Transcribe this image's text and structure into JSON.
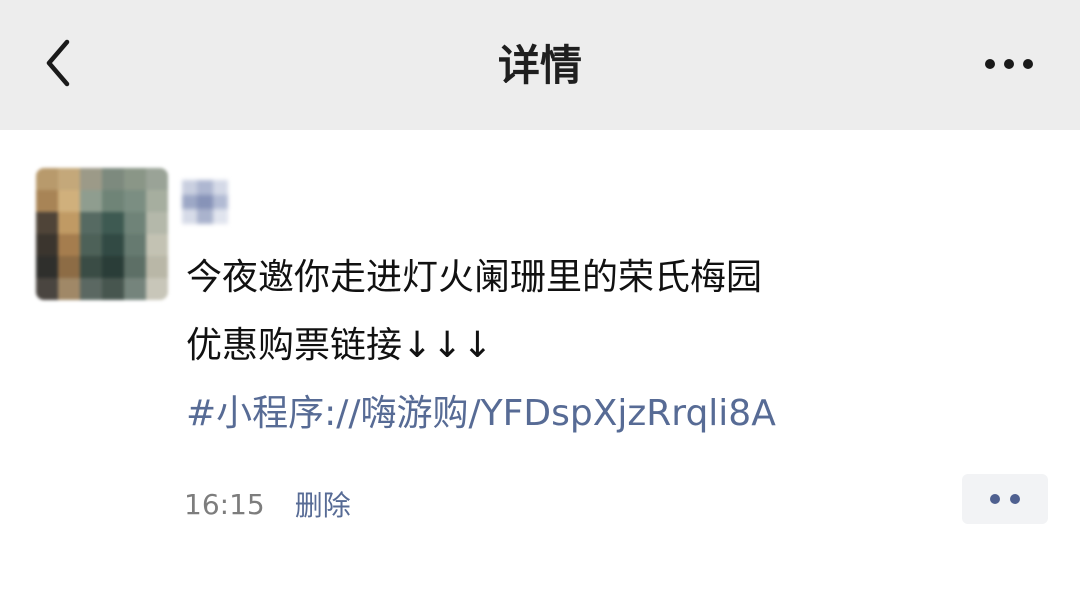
{
  "header": {
    "title": "详情",
    "back_icon": "chevron-left-icon",
    "more_icon": "more-horizontal-icon"
  },
  "post": {
    "text_line_1": "今夜邀你走进灯火阑珊里的荣氏梅园",
    "text_line_2": "优惠购票链接↓↓↓",
    "link_text": "#小程序://嗨游购/YFDspXjzRrqli8A",
    "time": "16:15",
    "delete_label": "删除",
    "action_icon": "more-dots-icon"
  },
  "colors": {
    "header_bg": "#ededed",
    "link": "#576b95",
    "text": "#111111",
    "meta": "#7d7d7d"
  }
}
